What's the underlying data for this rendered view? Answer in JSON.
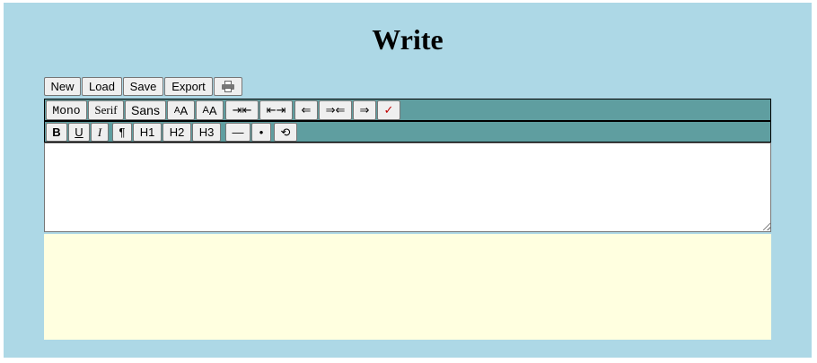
{
  "title": "Write",
  "file_toolbar": {
    "new_label": "New",
    "load_label": "Load",
    "save_label": "Save",
    "export_label": "Export",
    "print_icon": "printer-icon"
  },
  "format_toolbar": {
    "mono_label": "Mono",
    "serif_label": "Serif",
    "sans_label": "Sans",
    "font_smaller_small": "A",
    "font_smaller_big": "A",
    "font_larger_big": "A",
    "font_larger_small": "A",
    "indent_label": "⇥⇤",
    "outdent_label": "⇤⇥",
    "align_left_label": "⇐",
    "align_center_label": "⇒⇐",
    "align_right_label": "⇒",
    "spellcheck_label": "✓"
  },
  "style_toolbar": {
    "bold_label": "B",
    "underline_label": "U",
    "italic_label": "I",
    "paragraph_label": "¶",
    "h1_label": "H1",
    "h2_label": "H2",
    "h3_label": "H3",
    "hr_label": "—",
    "bullet_label": "•",
    "undo_label": "⟲"
  },
  "editor": {
    "value": ""
  },
  "colors": {
    "background": "#add8e6",
    "toolbar": "#5f9ea0",
    "preview": "#ffffe0",
    "spellcheck": "#c00000"
  }
}
